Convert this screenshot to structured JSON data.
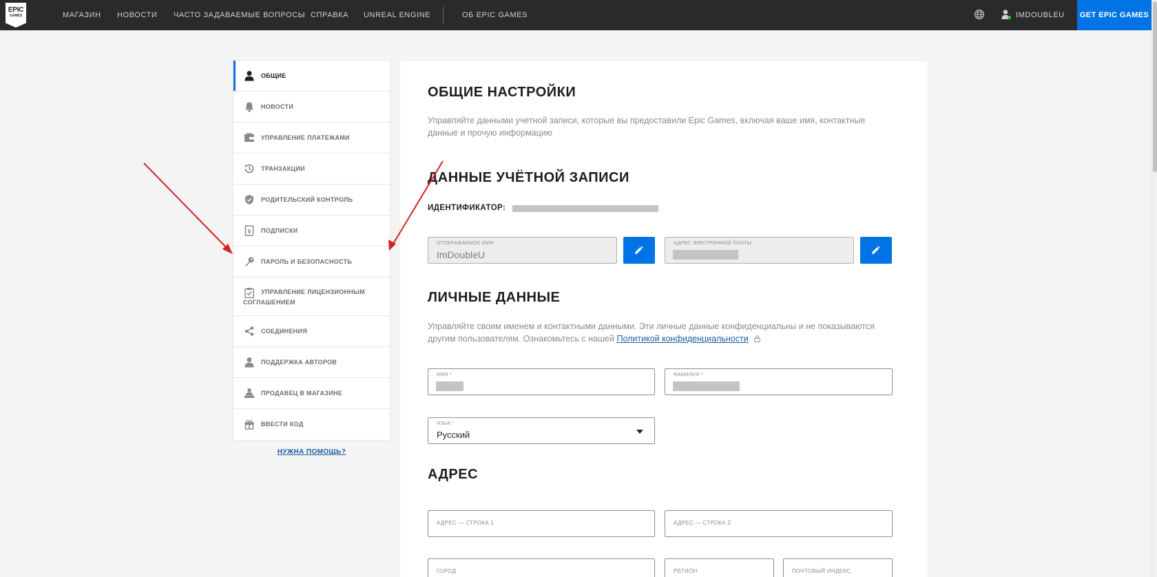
{
  "nav": {
    "logo_line1": "EPIC",
    "logo_line2": "GAMES",
    "links": [
      "МАГАЗИН",
      "НОВОСТИ",
      "ЧАСТО ЗАДАВАЕМЫЕ ВОПРОСЫ",
      "СПРАВКА",
      "UNREAL ENGINE",
      "ОБ EPIC GAMES"
    ],
    "username": "IMDOUBLEU",
    "get_button": "GET EPIC GAMES"
  },
  "sidebar": {
    "items": [
      {
        "label": "ОБЩИЕ",
        "icon": "user-icon",
        "active": true
      },
      {
        "label": "НОВОСТИ",
        "icon": "bell-icon"
      },
      {
        "label": "УПРАВЛЕНИЕ ПЛАТЕЖАМИ",
        "icon": "wallet-icon"
      },
      {
        "label": "ТРАНЗАКЦИИ",
        "icon": "history-icon"
      },
      {
        "label": "РОДИТЕЛЬСКИЙ КОНТРОЛЬ",
        "icon": "shield-icon"
      },
      {
        "label": "ПОДПИСКИ",
        "icon": "subscription-icon"
      },
      {
        "label": "ПАРОЛЬ И БЕЗОПАСНОСТЬ",
        "icon": "key-icon"
      },
      {
        "label": "УПРАВЛЕНИЕ ЛИЦЕНЗИОННЫМ СОГЛАШЕНИЕМ",
        "icon": "clipboard-check-icon"
      },
      {
        "label": "СОЕДИНЕНИЯ",
        "icon": "share-icon"
      },
      {
        "label": "ПОДДЕРЖКА АВТОРОВ",
        "icon": "creator-icon"
      },
      {
        "label": "ПРОДАВЕЦ В МАГАЗИНЕ",
        "icon": "seller-icon"
      },
      {
        "label": "ВВЕСТИ КОД",
        "icon": "gift-icon"
      }
    ],
    "help_link": "НУЖНА ПОМОЩЬ?"
  },
  "main": {
    "general_title": "ОБЩИЕ НАСТРОЙКИ",
    "general_desc": "Управляйте данными учетной записи, которые вы предоставили Epic Games, включая ваше имя, контактные данные и прочую информацию",
    "account_title": "ДАННЫЕ УЧЁТНОЙ ЗАПИСИ",
    "id_label": "ИДЕНТИФИКАТОР:",
    "display_name_label": "ОТОБРАЖАЕМОЕ ИМЯ",
    "display_name_value": "ImDoubleU",
    "email_label": "АДРЕС ЭЛЕКТРОННОЙ ПОЧТЫ",
    "personal_title": "ЛИЧНЫЕ ДАННЫЕ",
    "personal_desc": "Управляйте своим именем и контактными данными. Эти личные данные конфиденциальны и не показываются другим пользователям. Ознакомьтесь с нашей ",
    "privacy_link": "Политикой конфиденциальности",
    "first_name_label": "ИМЯ *",
    "last_name_label": "ФАМИЛИЯ *",
    "language_label": "ЯЗЫК *",
    "language_value": "Русский",
    "address_title": "АДРЕС",
    "address1_label": "АДРЕС — СТРОКА 1",
    "address2_label": "АДРЕС — СТРОКА 2",
    "city_label": "ГОРОД",
    "region_label": "РЕГИОН",
    "postal_label": "ПОЧТОВЫЙ ИНДЕКС"
  },
  "colors": {
    "accent": "#0074e4",
    "topbar": "#2a2a2a",
    "annotation_arrow": "#d42020"
  }
}
